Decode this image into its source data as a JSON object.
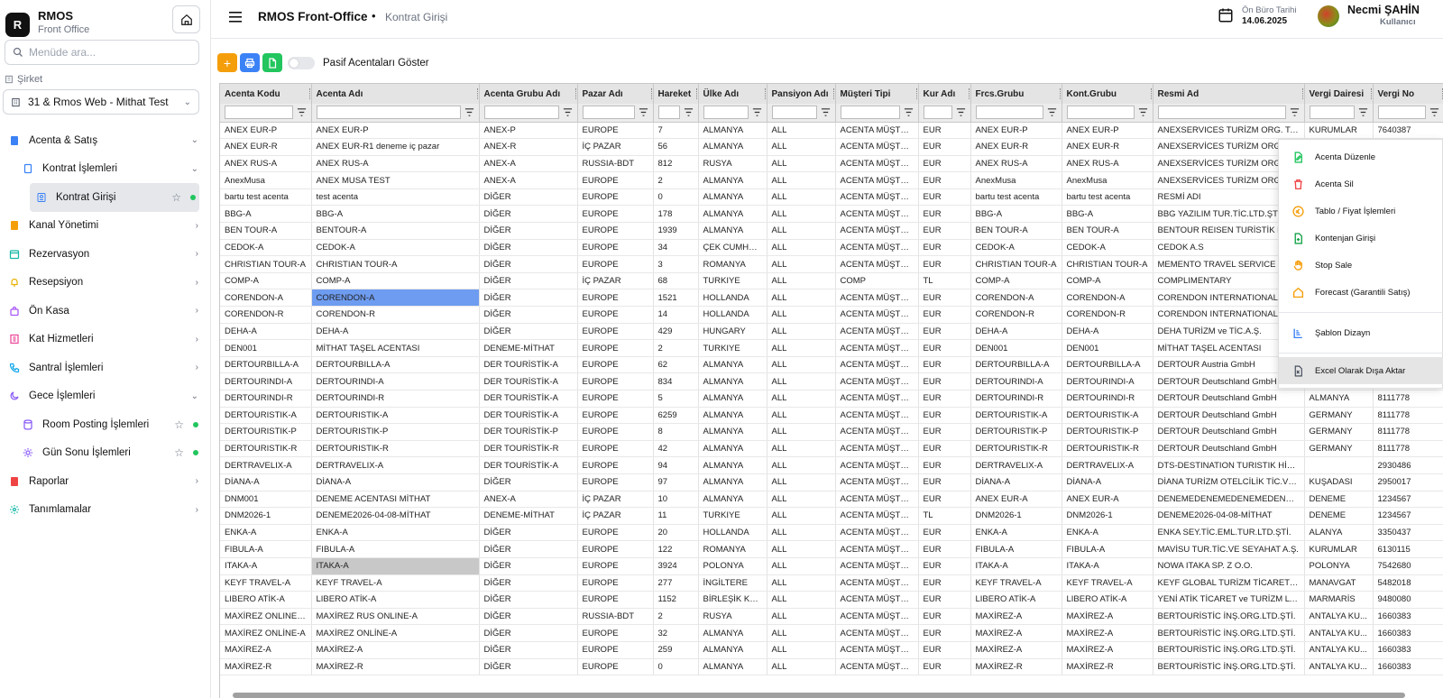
{
  "brand": {
    "title": "RMOS",
    "subtitle": "Front Office",
    "logo_letter": "R"
  },
  "sidebar": {
    "search_placeholder": "Menüde ara...",
    "company_label": "Şirket",
    "company_value": "31 & Rmos Web - Mithat Test",
    "items": [
      {
        "label": "Acenta & Satış",
        "icon": "book-icon",
        "color": "#3b82f6",
        "chevron": "down"
      },
      {
        "label": "Kontrat İşlemleri",
        "icon": "book-icon",
        "color": "#3b82f6",
        "chevron": "down"
      },
      {
        "label": "Kontrat Girişi",
        "icon": "contract-icon",
        "color": "#3b82f6"
      },
      {
        "label": "Kanal Yönetimi",
        "icon": "book-icon",
        "color": "#f59e0b",
        "chevron": "right"
      },
      {
        "label": "Rezervasyon",
        "icon": "calendar-icon",
        "color": "#14b8a6",
        "chevron": "right"
      },
      {
        "label": "Resepsiyon",
        "icon": "bell-icon",
        "color": "#eab308",
        "chevron": "right"
      },
      {
        "label": "Ön Kasa",
        "icon": "bag-icon",
        "color": "#a855f7",
        "chevron": "right"
      },
      {
        "label": "Kat Hizmetleri",
        "icon": "building-icon",
        "color": "#ec4899",
        "chevron": "right"
      },
      {
        "label": "Santral İşlemleri",
        "icon": "phone-icon",
        "color": "#0ea5e9",
        "chevron": "right"
      },
      {
        "label": "Gece İşlemleri",
        "icon": "moon-icon",
        "color": "#8b5cf6",
        "chevron": "down"
      },
      {
        "label": "Room Posting İşlemleri",
        "icon": "database-icon",
        "color": "#8b5cf6"
      },
      {
        "label": "Gün Sonu İşlemleri",
        "icon": "sun-icon",
        "color": "#8b5cf6"
      },
      {
        "label": "Raporlar",
        "icon": "report-icon",
        "color": "#ef4444",
        "chevron": "right"
      },
      {
        "label": "Tanımlamalar",
        "icon": "gear-icon",
        "color": "#14b8a6",
        "chevron": "right"
      }
    ]
  },
  "header": {
    "title": "RMOS Front-Office",
    "separator": "•",
    "page": "Kontrat Girişi",
    "office_date_label": "Ön Büro Tarihi",
    "office_date": "14.06.2025",
    "user_name": "Necmi ŞAHİN",
    "user_role": "Kullanıcı"
  },
  "toolbar": {
    "toggle_label": "Pasif Acentaları Göster",
    "add": "+"
  },
  "grid": {
    "columns": [
      "Acenta Kodu",
      "Acenta Adı",
      "Acenta Grubu Adı",
      "Pazar Adı",
      "Hareket",
      "Ülke Adı",
      "Pansiyon Adı",
      "Müşteri Tipi",
      "Kur Adı",
      "Frcs.Grubu",
      "Kont.Grubu",
      "Resmi Ad",
      "Vergi Dairesi",
      "Vergi No"
    ],
    "rows": [
      [
        "ANEX EUR-P",
        "ANEX EUR-P",
        "ANEX-P",
        "EUROPE",
        "7",
        "ALMANYA",
        "ALL",
        "ACENTA MÜŞTERİ...",
        "EUR",
        "ANEX EUR-P",
        "ANEX EUR-P",
        "ANEXSERVICES TURİZM ORG. TAŞ. T...",
        "KURUMLAR",
        "7640387"
      ],
      [
        "ANEX EUR-R",
        "ANEX EUR-R1 deneme iç pazar",
        "ANEX-R",
        "İÇ PAZAR",
        "56",
        "ALMANYA",
        "ALL",
        "ACENTA MÜŞTERİ...",
        "EUR",
        "ANEX EUR-R",
        "ANEX EUR-R",
        "ANEXSERVİCES TURİZM ORG. TAŞ. T...",
        "",
        ""
      ],
      [
        "ANEX RUS-A",
        "ANEX RUS-A",
        "ANEX-A",
        "RUSSIA-BDT",
        "812",
        "RUSYA",
        "ALL",
        "ACENTA MÜŞTERİ...",
        "EUR",
        "ANEX RUS-A",
        "ANEX RUS-A",
        "ANEXSERVİCES TURİZM ORG. TAŞ. T...",
        "",
        ""
      ],
      [
        "AnexMusa",
        "ANEX MUSA TEST",
        "ANEX-A",
        "EUROPE",
        "2",
        "ALMANYA",
        "ALL",
        "ACENTA MÜŞTERİ...",
        "EUR",
        "AnexMusa",
        "AnexMusa",
        "ANEXSERVİCES TURİZM ORG. TAŞ. T...",
        "",
        ""
      ],
      [
        "bartu test acenta",
        "test acenta",
        "DİĞER",
        "EUROPE",
        "0",
        "ALMANYA",
        "ALL",
        "ACENTA MÜŞTERİ...",
        "EUR",
        "bartu test acenta",
        "bartu test acenta",
        "RESMİ ADI",
        "",
        ""
      ],
      [
        "BBG-A",
        "BBG-A",
        "DİĞER",
        "EUROPE",
        "178",
        "ALMANYA",
        "ALL",
        "ACENTA MÜŞTERİ...",
        "EUR",
        "BBG-A",
        "BBG-A",
        "BBG YAZILIM TUR.TİC.LTD.ŞTİ",
        "",
        ""
      ],
      [
        "BEN TOUR-A",
        "BENTOUR-A",
        "DİĞER",
        "EUROPE",
        "1939",
        "ALMANYA",
        "ALL",
        "ACENTA MÜŞTERİ...",
        "EUR",
        "BEN TOUR-A",
        "BEN TOUR-A",
        "BENTOUR REISEN TURİSTİK HİZM...",
        "",
        ""
      ],
      [
        "CEDOK-A",
        "CEDOK-A",
        "DİĞER",
        "EUROPE",
        "34",
        "ÇEK CUMHU...",
        "ALL",
        "ACENTA MÜŞTERİ...",
        "EUR",
        "CEDOK-A",
        "CEDOK-A",
        "CEDOK A.S",
        "",
        ""
      ],
      [
        "CHRISTIAN TOUR-A",
        "CHRISTIAN TOUR-A",
        "DİĞER",
        "EUROPE",
        "3",
        "ROMANYA",
        "ALL",
        "ACENTA MÜŞTERİ...",
        "EUR",
        "CHRISTIAN TOUR-A",
        "CHRISTIAN TOUR-A",
        "MEMENTO TRAVEL SERVICE TUR...",
        "",
        ""
      ],
      [
        "COMP-A",
        "COMP-A",
        "DİĞER",
        "İÇ PAZAR",
        "68",
        "TURKIYE",
        "ALL",
        "COMP",
        "TL",
        "COMP-A",
        "COMP-A",
        "COMPLIMENTARY",
        "",
        ""
      ],
      [
        "CORENDON-A",
        "CORENDON-A",
        "DİĞER",
        "EUROPE",
        "1521",
        "HOLLANDA",
        "ALL",
        "ACENTA MÜŞTERİ...",
        "EUR",
        "CORENDON-A",
        "CORENDON-A",
        "CORENDON INTERNATIONAL TR...",
        "",
        ""
      ],
      [
        "CORENDON-R",
        "CORENDON-R",
        "DİĞER",
        "EUROPE",
        "14",
        "HOLLANDA",
        "ALL",
        "ACENTA MÜŞTERİ...",
        "EUR",
        "CORENDON-R",
        "CORENDON-R",
        "CORENDON INTERNATIONAL TR...",
        "",
        ""
      ],
      [
        "DEHA-A",
        "DEHA-A",
        "DİĞER",
        "EUROPE",
        "429",
        "HUNGARY",
        "ALL",
        "ACENTA MÜŞTERİ...",
        "EUR",
        "DEHA-A",
        "DEHA-A",
        "DEHA TURİZM ve TİC.A.Ş.",
        "",
        ""
      ],
      [
        "DEN001",
        "MİTHAT TAŞEL ACENTASI",
        "DENEME-MİTHAT",
        "EUROPE",
        "2",
        "TURKIYE",
        "ALL",
        "ACENTA MÜŞTERİ...",
        "EUR",
        "DEN001",
        "DEN001",
        "MİTHAT TAŞEL ACENTASI",
        "",
        ""
      ],
      [
        "DERTOURBILLA-A",
        "DERTOURBILLA-A",
        "DER TOURİSTİK-A",
        "EUROPE",
        "62",
        "ALMANYA",
        "ALL",
        "ACENTA MÜŞTERİ...",
        "EUR",
        "DERTOURBILLA-A",
        "DERTOURBILLA-A",
        "DERTOUR Austria GmbH",
        "",
        ""
      ],
      [
        "DERTOURINDI-A",
        "DERTOURINDI-A",
        "DER TOURİSTİK-A",
        "EUROPE",
        "834",
        "ALMANYA",
        "ALL",
        "ACENTA MÜŞTERİ...",
        "EUR",
        "DERTOURINDI-A",
        "DERTOURINDI-A",
        "DERTOUR Deutschland GmbH",
        "",
        ""
      ],
      [
        "DERTOURINDI-R",
        "DERTOURINDI-R",
        "DER TOURİSTİK-A",
        "EUROPE",
        "5",
        "ALMANYA",
        "ALL",
        "ACENTA MÜŞTERİ...",
        "EUR",
        "DERTOURINDI-R",
        "DERTOURINDI-R",
        "DERTOUR Deutschland GmbH",
        "ALMANYA",
        "8111778"
      ],
      [
        "DERTOURISTIK-A",
        "DERTOURISTIK-A",
        "DER TOURİSTİK-A",
        "EUROPE",
        "6259",
        "ALMANYA",
        "ALL",
        "ACENTA MÜŞTERİ...",
        "EUR",
        "DERTOURISTIK-A",
        "DERTOURISTIK-A",
        "DERTOUR Deutschland GmbH",
        "GERMANY",
        "8111778"
      ],
      [
        "DERTOURISTIK-P",
        "DERTOURISTIK-P",
        "DER TOURİSTİK-P",
        "EUROPE",
        "8",
        "ALMANYA",
        "ALL",
        "ACENTA MÜŞTERİ...",
        "EUR",
        "DERTOURISTIK-P",
        "DERTOURISTIK-P",
        "DERTOUR Deutschland GmbH",
        "GERMANY",
        "8111778"
      ],
      [
        "DERTOURISTIK-R",
        "DERTOURISTIK-R",
        "DER TOURİSTİK-R",
        "EUROPE",
        "42",
        "ALMANYA",
        "ALL",
        "ACENTA MÜŞTERİ...",
        "EUR",
        "DERTOURISTIK-R",
        "DERTOURISTIK-R",
        "DERTOUR Deutschland GmbH",
        "GERMANY",
        "8111778"
      ],
      [
        "DERTRAVELIX-A",
        "DERTRAVELIX-A",
        "DER TOURİSTİK-A",
        "EUROPE",
        "94",
        "ALMANYA",
        "ALL",
        "ACENTA MÜŞTERİ...",
        "EUR",
        "DERTRAVELIX-A",
        "DERTRAVELIX-A",
        "DTS-DESTINATION TURISTIK HİZ.TİC...",
        "",
        "2930486"
      ],
      [
        "DİANA-A",
        "DİANA-A",
        "DİĞER",
        "EUROPE",
        "97",
        "ALMANYA",
        "ALL",
        "ACENTA MÜŞTERİ...",
        "EUR",
        "DİANA-A",
        "DİANA-A",
        "DİANA TURİZM OTELCİLİK TİC.VE SA...",
        "KUŞADASI",
        "2950017"
      ],
      [
        "DNM001",
        "DENEME ACENTASI MİTHAT",
        "ANEX-A",
        "İÇ PAZAR",
        "10",
        "ALMANYA",
        "ALL",
        "ACENTA MÜŞTERİ...",
        "EUR",
        "ANEX EUR-A",
        "ANEX EUR-A",
        "DENEMEDENEMEDENEMEDENEME...",
        "DENEME",
        "1234567"
      ],
      [
        "DNM2026-1",
        "DENEME2026-04-08-MİTHAT",
        "DENEME-MİTHAT",
        "İÇ PAZAR",
        "11",
        "TURKIYE",
        "ALL",
        "ACENTA MÜŞTERİ...",
        "TL",
        "DNM2026-1",
        "DNM2026-1",
        "DENEME2026-04-08-MİTHAT",
        "DENEME",
        "1234567"
      ],
      [
        "ENKA-A",
        "ENKA-A",
        "DİĞER",
        "EUROPE",
        "20",
        "HOLLANDA",
        "ALL",
        "ACENTA MÜŞTERİ...",
        "EUR",
        "ENKA-A",
        "ENKA-A",
        "ENKA SEY.TİC.EML.TUR.LTD.ŞTİ.",
        "ALANYA",
        "3350437"
      ],
      [
        "FIBULA-A",
        "FIBULA-A",
        "DİĞER",
        "EUROPE",
        "122",
        "ROMANYA",
        "ALL",
        "ACENTA MÜŞTERİ...",
        "EUR",
        "FIBULA-A",
        "FIBULA-A",
        "MAVİSU TUR.TİC.VE SEYAHAT A.Ş.",
        "KURUMLAR",
        "6130115"
      ],
      [
        "ITAKA-A",
        "ITAKA-A",
        "DİĞER",
        "EUROPE",
        "3924",
        "POLONYA",
        "ALL",
        "ACENTA MÜŞTERİ...",
        "EUR",
        "ITAKA-A",
        "ITAKA-A",
        "NOWA ITAKA SP. Z O.O.",
        "POLONYA",
        "7542680"
      ],
      [
        "KEYF TRAVEL-A",
        "KEYF TRAVEL-A",
        "DİĞER",
        "EUROPE",
        "277",
        "İNGİLTERE",
        "ALL",
        "ACENTA MÜŞTERİ...",
        "EUR",
        "KEYF TRAVEL-A",
        "KEYF TRAVEL-A",
        "KEYF GLOBAL TURİZM TİCARET A.Ş.",
        "MANAVGAT",
        "5482018"
      ],
      [
        "LIBERO ATİK-A",
        "LIBERO ATİK-A",
        "DİĞER",
        "EUROPE",
        "1152",
        "BİRLEŞİK KRA...",
        "ALL",
        "ACENTA MÜŞTERİ...",
        "EUR",
        "LIBERO ATİK-A",
        "LIBERO ATİK-A",
        "YENİ ATİK TİCARET ve TURİZM LTD.ŞTİ",
        "MARMARİS",
        "9480080"
      ],
      [
        "MAXİREZ ONLINE R...",
        "MAXİREZ RUS ONLINE-A",
        "DİĞER",
        "RUSSIA-BDT",
        "2",
        "RUSYA",
        "ALL",
        "ACENTA MÜŞTERİ...",
        "EUR",
        "MAXİREZ-A",
        "MAXİREZ-A",
        "BERTOURİSTİC İNŞ.ORG.LTD.ŞTİ.",
        "ANTALYA KU...",
        "1660383"
      ],
      [
        "MAXİREZ ONLİNE-A",
        "MAXİREZ ONLİNE-A",
        "DİĞER",
        "EUROPE",
        "32",
        "ALMANYA",
        "ALL",
        "ACENTA MÜŞTERİ...",
        "EUR",
        "MAXİREZ-A",
        "MAXİREZ-A",
        "BERTOURİSTİC İNŞ.ORG.LTD.ŞTİ.",
        "ANTALYA KU...",
        "1660383"
      ],
      [
        "MAXİREZ-A",
        "MAXİREZ-A",
        "DİĞER",
        "EUROPE",
        "259",
        "ALMANYA",
        "ALL",
        "ACENTA MÜŞTERİ...",
        "EUR",
        "MAXİREZ-A",
        "MAXİREZ-A",
        "BERTOURİSTİC İNŞ.ORG.LTD.ŞTİ.",
        "ANTALYA KU...",
        "1660383"
      ],
      [
        "MAXİREZ-R",
        "MAXİREZ-R",
        "DİĞER",
        "EUROPE",
        "0",
        "ALMANYA",
        "ALL",
        "ACENTA MÜŞTERİ...",
        "EUR",
        "MAXİREZ-R",
        "MAXİREZ-R",
        "BERTOURİSTİC İNŞ.ORG.LTD.ŞTİ.",
        "ANTALYA KU...",
        "1660383"
      ]
    ]
  },
  "context_menu": {
    "items": [
      {
        "label": "Acenta Düzenle",
        "icon": "edit-icon",
        "color": "#22c55e"
      },
      {
        "label": "Acenta Sil",
        "icon": "trash-icon",
        "color": "#ef4444"
      },
      {
        "label": "Tablo / Fiyat İşlemleri",
        "icon": "euro-icon",
        "color": "#f59e0b"
      },
      {
        "label": "Kontenjan Girişi",
        "icon": "add-file-icon",
        "color": "#16a34a"
      },
      {
        "label": "Stop Sale",
        "icon": "hand-icon",
        "color": "#f59e0b"
      },
      {
        "label": "Forecast (Garantili Satış)",
        "icon": "house-icon",
        "color": "#f59e0b"
      },
      {
        "label": "Şablon Dizayn",
        "icon": "layout-icon",
        "color": "#3b82f6"
      },
      {
        "label": "Excel Olarak Dışa Aktar",
        "icon": "excel-icon",
        "color": "#374151"
      }
    ]
  }
}
